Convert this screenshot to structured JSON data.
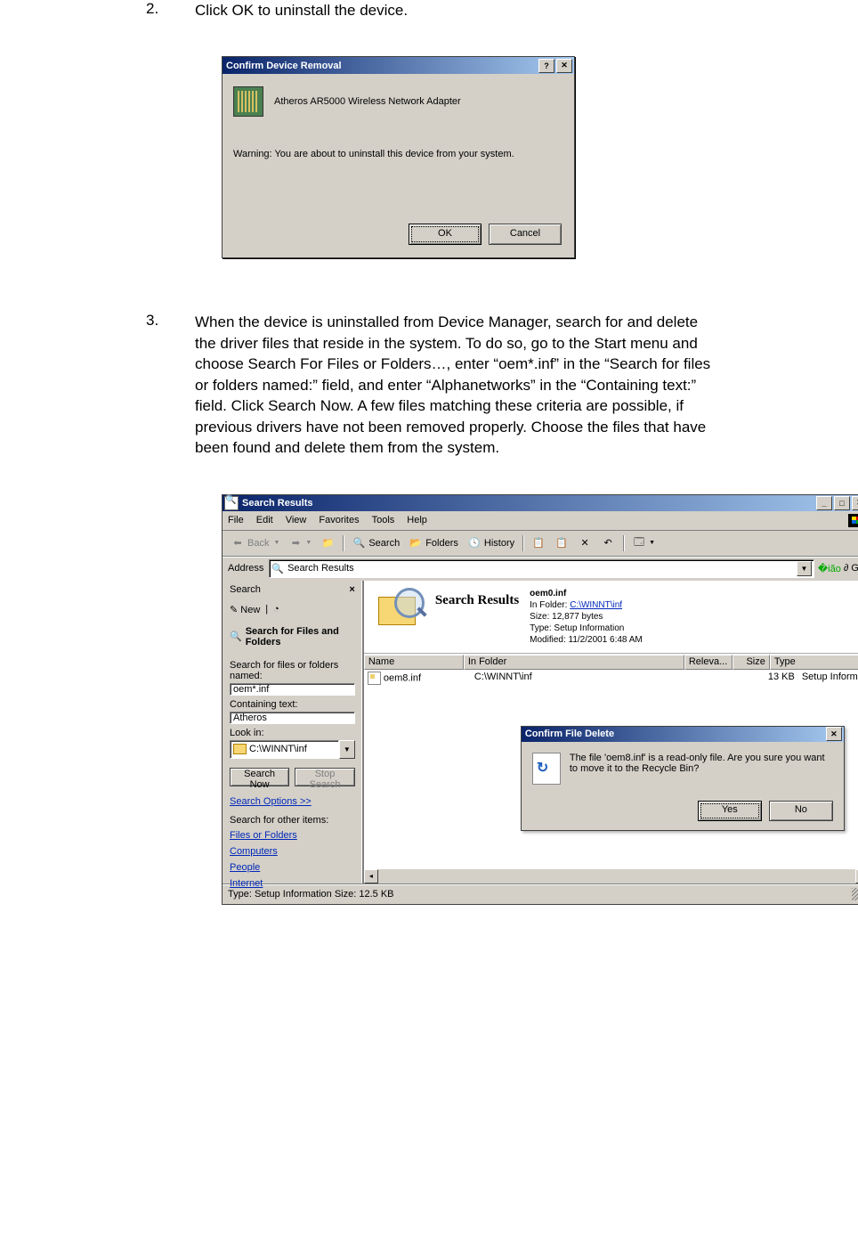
{
  "step2": {
    "num": "2.",
    "text": "Click OK to uninstall the device."
  },
  "dialog1": {
    "title": "Confirm Device Removal",
    "help_btn": "?",
    "close_btn": "✕",
    "device_name": "Atheros AR5000 Wireless Network Adapter",
    "warning": "Warning: You are about to uninstall this device from your system.",
    "ok": "OK",
    "cancel": "Cancel"
  },
  "step3": {
    "num": "3.",
    "text": "When the device is uninstalled from Device Manager, search for and delete the driver files that reside in the system. To do so, go to the Start menu and choose Search For Files or Folders…, enter “oem*.inf” in the “Search for files or folders named:” field, and enter “Alphanetworks” in the “Containing text:” field. Click Search Now. A few files matching these criteria are possible, if previous drivers have not been removed properly. Choose the files that have been found and delete them from the system."
  },
  "explorer": {
    "title": "Search Results",
    "min": "_",
    "max": "□",
    "close": "✕",
    "menus": [
      "File",
      "Edit",
      "View",
      "Favorites",
      "Tools",
      "Help"
    ],
    "toolbar": {
      "back": "Back",
      "forward": "",
      "up": "",
      "search": "Search",
      "folders": "Folders",
      "history": "History"
    },
    "addr_label": "Address",
    "addr_value": "Search Results",
    "go": "Go",
    "search_pane": {
      "head": "Search",
      "new": "New",
      "section": "Search for Files and Folders",
      "named_label": "Search for files or folders named:",
      "named_value": "oem*.inf",
      "contain_label": "Containing text:",
      "contain_value": "Atheros",
      "lookin_label": "Look in:",
      "lookin_value": "C:\\WINNT\\inf",
      "search_now": "Search Now",
      "stop": "Stop Search",
      "options": "Search Options  >>",
      "other_label": "Search for other items:",
      "links": [
        "Files or Folders",
        "Computers",
        "People",
        "Internet"
      ]
    },
    "banner": {
      "heading": "Search Results",
      "filename": "oem0.inf",
      "folder_label": "In Folder:",
      "folder": "C:\\WINNT\\inf",
      "size": "Size: 12,877 bytes",
      "type": "Type: Setup Information",
      "modified": "Modified: 11/2/2001 6:48 AM"
    },
    "columns": {
      "name": "Name",
      "folder": "In Folder",
      "relev": "Releva...",
      "size": "Size",
      "type": "Type"
    },
    "row": {
      "name": "oem8.inf",
      "folder": "C:\\WINNT\\inf",
      "relev": "",
      "size": "13 KB",
      "type": "Setup Informat"
    },
    "status": "Type: Setup Information Size: 12.5 KB"
  },
  "confirm_delete": {
    "title": "Confirm File Delete",
    "close": "✕",
    "message": "The file 'oem8.inf' is a read-only file. Are you sure you want to move it to the Recycle Bin?",
    "yes": "Yes",
    "no": "No"
  }
}
